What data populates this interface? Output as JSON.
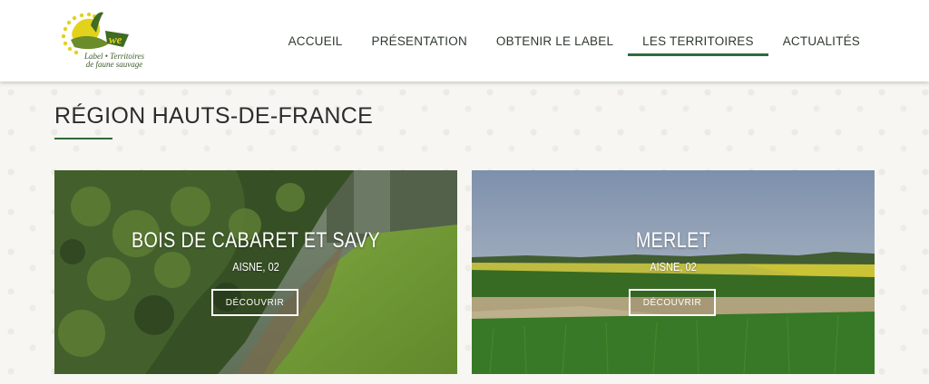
{
  "logo": {
    "text_line1": "Label • Territoires",
    "text_line2": "de faune sauvage"
  },
  "nav": {
    "items": [
      {
        "label": "ACCUEIL"
      },
      {
        "label": "PRÉSENTATION"
      },
      {
        "label": "OBTENIR LE LABEL"
      },
      {
        "label": "LES TERRITOIRES",
        "active": true
      },
      {
        "label": "ACTUALITÉS"
      }
    ]
  },
  "page": {
    "title": "RÉGION HAUTS-DE-FRANCE"
  },
  "cards": [
    {
      "title": "BOIS DE CABARET ET SAVY",
      "location": "AISNE, 02",
      "button": "DÉCOUVRIR"
    },
    {
      "title": "MERLET",
      "location": "AISNE, 02",
      "button": "DÉCOUVRIR"
    }
  ],
  "colors": {
    "accent": "#2f6b3a",
    "logo_yellow": "#e3d21c",
    "logo_green": "#6b8c2a"
  }
}
